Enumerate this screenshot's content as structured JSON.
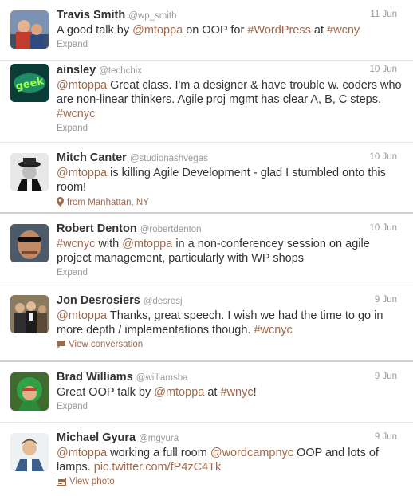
{
  "tweets": [
    {
      "name": "Travis Smith",
      "handle": "@wp_smith",
      "date": "11 Jun",
      "segments": [
        {
          "t": "A good talk by ",
          "h": false
        },
        {
          "t": "@mtoppa",
          "h": true
        },
        {
          "t": " on OOP for ",
          "h": false
        },
        {
          "t": "#WordPress",
          "h": true
        },
        {
          "t": " at ",
          "h": false
        },
        {
          "t": "#wcny",
          "h": true
        }
      ],
      "action": "Expand"
    },
    {
      "name": "ainsley",
      "handle": "@techchix",
      "date": "10 Jun",
      "segments": [
        {
          "t": "@mtoppa",
          "h": true
        },
        {
          "t": " Great class. I'm a designer & have trouble w. coders who are non-linear thinkers. Agile proj mgmt has clear A, B, C steps. ",
          "h": false
        },
        {
          "t": "#wcnyc",
          "h": true
        }
      ],
      "action": "Expand"
    },
    {
      "name": "Mitch Canter",
      "handle": "@studionashvegas",
      "date": "10 Jun",
      "segments": [
        {
          "t": "@mtoppa",
          "h": true
        },
        {
          "t": " is killing Agile Development - glad I stumbled onto this room!",
          "h": false
        }
      ],
      "action": "from Manhattan, NY"
    },
    {
      "name": "Robert Denton",
      "handle": "@robertdenton",
      "date": "10 Jun",
      "segments": [
        {
          "t": "#wcnyc",
          "h": true
        },
        {
          "t": " with ",
          "h": false
        },
        {
          "t": "@mtoppa",
          "h": true
        },
        {
          "t": " in a non-conferencey session on agile project management, particularly with WP shops",
          "h": false
        }
      ],
      "action": "Expand"
    },
    {
      "name": "Jon Desrosiers",
      "handle": "@desrosj",
      "date": "9 Jun",
      "segments": [
        {
          "t": "@mtoppa",
          "h": true
        },
        {
          "t": " Thanks, great speech. I wish we had the time to go in more depth / implementations though. ",
          "h": false
        },
        {
          "t": "#wcnyc",
          "h": true
        }
      ],
      "action": "View conversation"
    },
    {
      "name": "Brad Williams",
      "handle": "@williamsba",
      "date": "9 Jun",
      "segments": [
        {
          "t": "Great OOP talk by ",
          "h": false
        },
        {
          "t": "@mtoppa",
          "h": true
        },
        {
          "t": " at ",
          "h": false
        },
        {
          "t": "#wnyc",
          "h": true
        },
        {
          "t": "!",
          "h": false
        }
      ],
      "action": "Expand"
    },
    {
      "name": "Michael Gyura",
      "handle": "@mgyura",
      "date": "9 Jun",
      "segments": [
        {
          "t": "@mtoppa",
          "h": true
        },
        {
          "t": " working a full room ",
          "h": false
        },
        {
          "t": "@wordcampnyc",
          "h": true
        },
        {
          "t": " OOP and lots of lamps. ",
          "h": false
        },
        {
          "t": "pic.twitter.com/fP4zC4Tk",
          "h": true
        }
      ],
      "action": "View photo"
    }
  ],
  "colors": {
    "link": "#a0694a",
    "muted": "#999999",
    "text": "#333333"
  },
  "icons": [
    "avatar",
    "location-pin-icon",
    "conversation-icon",
    "photo-icon"
  ]
}
